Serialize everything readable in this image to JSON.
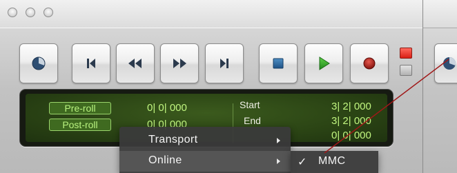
{
  "window": {
    "traffic_lights": [
      "close",
      "minimize",
      "zoom"
    ]
  },
  "toolbar": {
    "buttons": [
      {
        "name": "online-button",
        "icon": "pie-clock-icon"
      },
      {
        "name": "return-to-zero-button",
        "icon": "skip-to-start-icon"
      },
      {
        "name": "rewind-button",
        "icon": "rewind-icon"
      },
      {
        "name": "fast-forward-button",
        "icon": "fast-forward-icon"
      },
      {
        "name": "go-to-end-button",
        "icon": "skip-to-end-icon"
      },
      {
        "name": "stop-button",
        "icon": "stop-square-icon"
      },
      {
        "name": "play-button",
        "icon": "play-triangle-icon"
      },
      {
        "name": "record-button",
        "icon": "record-dot-icon"
      }
    ],
    "indicators": {
      "top_color": "#e12a1f",
      "bottom_color": "#bdbdbd"
    }
  },
  "counter": {
    "preroll_label": "Pre-roll",
    "postroll_label": "Post-roll",
    "preroll_value": "0| 0| 000",
    "postroll_value": "0| 0| 000",
    "start_label": "Start",
    "end_label": "End",
    "start_value": "3| 2| 000",
    "end_value": "3| 2| 000",
    "length_value": "0| 0| 000"
  },
  "context_menu": {
    "items": [
      {
        "label": "Transport",
        "has_submenu": true
      },
      {
        "label": "Online",
        "has_submenu": true
      }
    ],
    "submenu": {
      "check": "✓",
      "label": "MMC"
    }
  },
  "colors": {
    "lcd_text": "#c0f57f",
    "menu_bg": "#3a3a3a",
    "annotation_line": "#a01818"
  }
}
